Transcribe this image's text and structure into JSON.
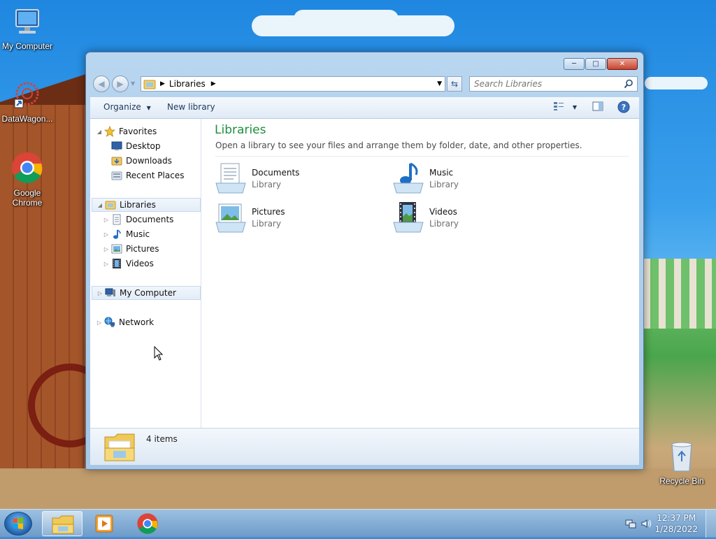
{
  "desktop": {
    "icons": [
      {
        "label": "My Computer"
      },
      {
        "label": "DataWagon..."
      },
      {
        "label": "Google Chrome"
      },
      {
        "label": "Recycle Bin"
      }
    ]
  },
  "window": {
    "address": {
      "segment": "Libraries"
    },
    "search": {
      "placeholder": "Search Libraries"
    },
    "toolbar": {
      "organize": "Organize",
      "new_library": "New library"
    },
    "nav_tree": {
      "favorites": {
        "label": "Favorites",
        "items": [
          "Desktop",
          "Downloads",
          "Recent Places"
        ]
      },
      "libraries": {
        "label": "Libraries",
        "items": [
          "Documents",
          "Music",
          "Pictures",
          "Videos"
        ]
      },
      "my_computer": "My Computer",
      "network": "Network"
    },
    "main": {
      "title": "Libraries",
      "subtitle": "Open a library to see your files and arrange them by folder, date, and other properties.",
      "libraries": [
        {
          "name": "Documents",
          "kind": "Library",
          "icon": "documents-icon"
        },
        {
          "name": "Music",
          "kind": "Library",
          "icon": "music-icon"
        },
        {
          "name": "Pictures",
          "kind": "Library",
          "icon": "pictures-icon"
        },
        {
          "name": "Videos",
          "kind": "Library",
          "icon": "videos-icon"
        }
      ]
    },
    "details": {
      "count": "4 items"
    }
  },
  "taskbar": {
    "clock": {
      "time": "12:37 PM",
      "date": "1/28/2022"
    }
  },
  "colors": {
    "title_green": "#1e8f3e",
    "toolbar_text": "#1e395b",
    "accent": "#2b5e98"
  }
}
